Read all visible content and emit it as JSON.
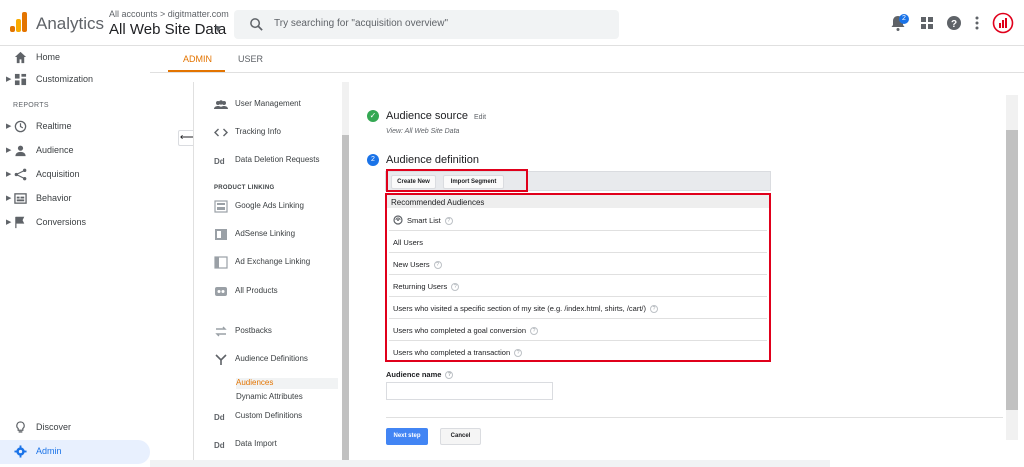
{
  "topbar": {
    "app_name": "Analytics",
    "account_crumb": "All accounts > digitmatter.com",
    "property": "All Web Site Data",
    "search_placeholder": "Try searching for \"acquisition overview\"",
    "notification_count": "2"
  },
  "leftnav": {
    "items": [
      {
        "label": "Home",
        "icon": "home-icon"
      },
      {
        "label": "Customization",
        "icon": "customization-icon"
      },
      {
        "label": "Realtime",
        "icon": "clock-icon"
      },
      {
        "label": "Audience",
        "icon": "person-icon"
      },
      {
        "label": "Acquisition",
        "icon": "acquisition-icon"
      },
      {
        "label": "Behavior",
        "icon": "behavior-icon"
      },
      {
        "label": "Conversions",
        "icon": "flag-icon"
      }
    ],
    "reports_header": "REPORTS",
    "discover": "Discover",
    "admin": "Admin"
  },
  "tabs": {
    "admin": "ADMIN",
    "user": "USER"
  },
  "panel": {
    "items_top": [
      {
        "label": "User Management",
        "icon": "users-icon"
      },
      {
        "label": "Tracking Info",
        "icon": "code-icon"
      },
      {
        "label": "Data Deletion Requests",
        "icon": "dd-icon"
      }
    ],
    "product_linking_header": "PRODUCT LINKING",
    "items_linking": [
      {
        "label": "Google Ads Linking",
        "icon": "google-ads-icon"
      },
      {
        "label": "AdSense Linking",
        "icon": "adsense-icon"
      },
      {
        "label": "Ad Exchange Linking",
        "icon": "ad-exchange-icon"
      },
      {
        "label": "All Products",
        "icon": "all-products-icon"
      }
    ],
    "postbacks": "Postbacks",
    "audience_definitions": "Audience Definitions",
    "audiences": "Audiences",
    "dynamic_attributes": "Dynamic Attributes",
    "custom_definitions": "Custom Definitions",
    "data_import": "Data Import"
  },
  "main": {
    "step1_title": "Audience source",
    "step1_edit": "Edit",
    "step1_view": "View: All Web Site Data",
    "step2_num": "2",
    "step2_title": "Audience definition",
    "create_new": "Create New",
    "import_segment": "Import Segment",
    "recommended_header": "Recommended Audiences",
    "recommended": [
      {
        "label": "Smart List",
        "help": true,
        "icon": "smart-list-icon"
      },
      {
        "label": "All Users",
        "help": false
      },
      {
        "label": "New Users",
        "help": true
      },
      {
        "label": "Returning Users",
        "help": true
      },
      {
        "label": "Users who visited a specific section of my site (e.g. /index.html, shirts, /cart/)",
        "help": true
      },
      {
        "label": "Users who completed a goal conversion",
        "help": true
      },
      {
        "label": "Users who completed a transaction",
        "help": true
      }
    ],
    "audience_name_label": "Audience name",
    "audience_name_value": "",
    "next_step": "Next step",
    "cancel": "Cancel"
  },
  "colors": {
    "accent": "#e37400",
    "link_blue": "#1a73e8",
    "highlight_red": "#e0001b",
    "success_green": "#34a853"
  }
}
